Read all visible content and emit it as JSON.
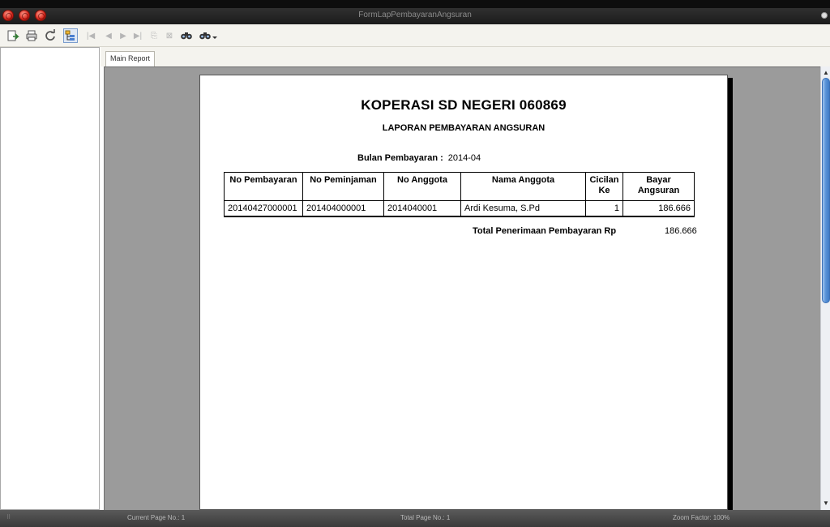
{
  "window": {
    "title": "FormLapPembayaranAngsuran"
  },
  "toolbar": {
    "buttons": [
      {
        "name": "export-icon"
      },
      {
        "name": "print-icon"
      },
      {
        "name": "refresh-icon"
      },
      {
        "name": "group-tree-icon"
      },
      {
        "name": "first-page-icon"
      },
      {
        "name": "prev-page-icon"
      },
      {
        "name": "next-page-icon"
      },
      {
        "name": "last-page-icon"
      },
      {
        "name": "goto-page-icon"
      },
      {
        "name": "close-view-icon"
      },
      {
        "name": "search-icon"
      },
      {
        "name": "zoom-icon"
      }
    ]
  },
  "tabs": {
    "main_report": "Main Report"
  },
  "report": {
    "title": "KOPERASI SD NEGERI 060869",
    "subtitle": "LAPORAN PEMBAYARAN ANGSURAN",
    "period_label": "Bulan Pembayaran :",
    "period_value": "2014-04",
    "columns": {
      "no_pembayaran": "No Pembayaran",
      "no_peminjaman": "No Peminjaman",
      "no_anggota": "No Anggota",
      "nama_anggota": "Nama Anggota",
      "cicilan_ke_1": "Cicilan",
      "cicilan_ke_2": "Ke",
      "bayar_angsuran": "Bayar Angsuran"
    },
    "rows": [
      {
        "no_pembayaran": "20140427000001",
        "no_peminjaman": "201404000001",
        "no_anggota": "2014040001",
        "nama_anggota": "Ardi Kesuma, S.Pd",
        "cicilan_ke": "1",
        "bayar_angsuran": "186.666"
      }
    ],
    "total_label": "Total Penerimaan Pembayaran Rp",
    "total_value": "186.666"
  },
  "status": {
    "current_page": "Current Page No.: 1",
    "total_page": "Total Page No.: 1",
    "zoom": "Zoom Factor: 100%"
  },
  "colors": {
    "viewer_background": "#9b9b9b",
    "scroll_thumb": "#5a93d8",
    "close_button": "#d6261b"
  }
}
